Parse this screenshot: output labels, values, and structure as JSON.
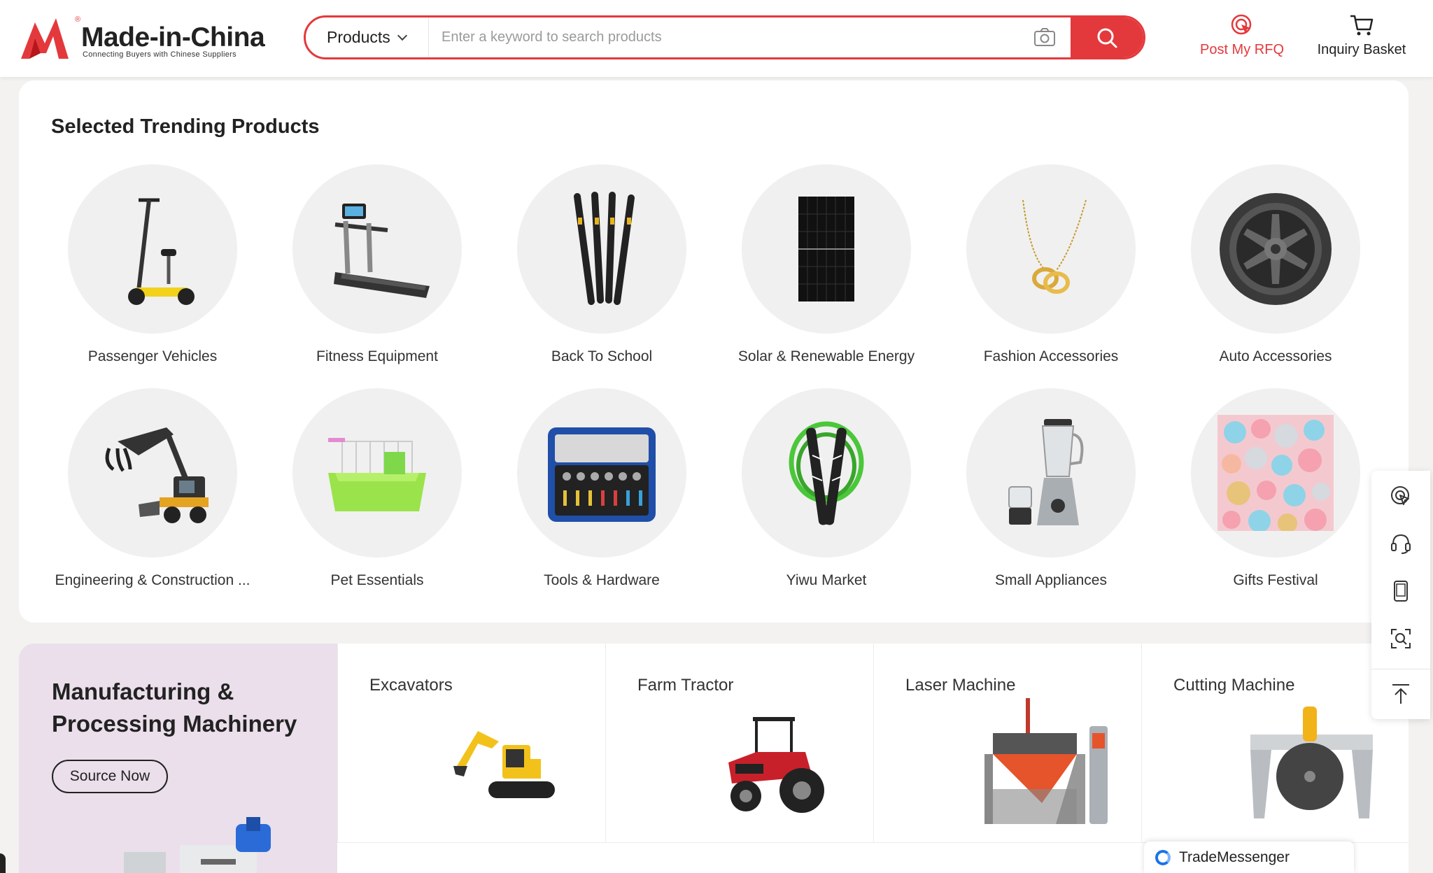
{
  "header": {
    "logo_text": "Made-in-China",
    "logo_tagline": "Connecting Buyers with Chinese Suppliers",
    "logo_reg": "®",
    "search": {
      "category": "Products",
      "placeholder": "Enter a keyword to search products"
    },
    "post_rfq": "Post My RFQ",
    "inquiry_basket": "Inquiry Basket"
  },
  "trending": {
    "title": "Selected Trending Products",
    "categories": [
      {
        "label": "Passenger Vehicles",
        "icon": "electric-scooter"
      },
      {
        "label": "Fitness Equipment",
        "icon": "treadmill"
      },
      {
        "label": "Back To School",
        "icon": "pens"
      },
      {
        "label": "Solar & Renewable Energy",
        "icon": "solar-panel"
      },
      {
        "label": "Fashion Accessories",
        "icon": "necklace"
      },
      {
        "label": "Auto Accessories",
        "icon": "alloy-wheel"
      },
      {
        "label": "Engineering & Construction ...",
        "icon": "material-handler"
      },
      {
        "label": "Pet Essentials",
        "icon": "pet-cage"
      },
      {
        "label": "Tools & Hardware",
        "icon": "tool-kit"
      },
      {
        "label": "Yiwu Market",
        "icon": "jump-rope"
      },
      {
        "label": "Small Appliances",
        "icon": "blender"
      },
      {
        "label": "Gifts Festival",
        "icon": "christmas-balls"
      }
    ]
  },
  "machinery": {
    "title": "Manufacturing & Processing Machinery",
    "cta": "Source Now",
    "items": [
      {
        "name": "Excavators",
        "icon": "excavator"
      },
      {
        "name": "Farm Tractor",
        "icon": "tractor"
      },
      {
        "name": "Laser Machine",
        "icon": "laser-cutter"
      },
      {
        "name": "Cutting Machine",
        "icon": "stone-saw"
      }
    ]
  },
  "messenger": {
    "label": "TradeMessenger"
  },
  "colors": {
    "brand_red": "#e4393c",
    "hero_bg": "#eadfeb"
  }
}
